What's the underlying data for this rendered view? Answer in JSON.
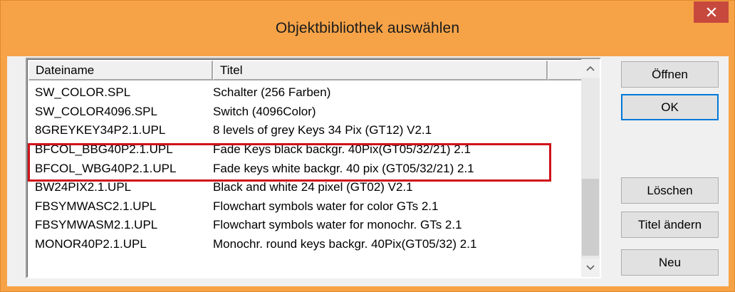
{
  "window": {
    "title": "Objektbibliothek auswählen",
    "close_symbol": "×"
  },
  "list": {
    "columns": [
      "Dateiname",
      "Titel",
      ""
    ],
    "rows": [
      {
        "file": "SW_COLOR.SPL",
        "title": "Schalter (256 Farben)"
      },
      {
        "file": "SW_COLOR4096.SPL",
        "title": "Switch (4096Color)"
      },
      {
        "file": "8GREYKEY34P2.1.UPL",
        "title": "8 levels of grey Keys 34 Pix (GT12) V2.1"
      },
      {
        "file": "BFCOL_BBG40P2.1.UPL",
        "title": "Fade Keys black backgr. 40Pix(GT05/32/21) 2.1"
      },
      {
        "file": "BFCOL_WBG40P2.1.UPL",
        "title": "Fade keys white backgr. 40 pix (GT05/32/21) 2.1"
      },
      {
        "file": "BW24PIX2.1.UPL",
        "title": "Black and white 24 pixel (GT02) V2.1"
      },
      {
        "file": "FBSYMWASC2.1.UPL",
        "title": "Flowchart symbols water for color GTs 2.1"
      },
      {
        "file": "FBSYMWASM2.1.UPL",
        "title": "Flowchart symbols water for monochr. GTs 2.1"
      },
      {
        "file": "MONOR40P2.1.UPL",
        "title": "Monochr. round keys backgr. 40Pix(GT05/32) 2.1"
      }
    ]
  },
  "buttons": {
    "open": "Öffnen",
    "ok": "OK",
    "delete": "Löschen",
    "rename_title": "Titel ändern",
    "new": "Neu"
  },
  "colors": {
    "titlebar": "#f6a348",
    "close_button": "#c7493e",
    "highlight_border": "#d0121b",
    "default_button_border": "#0078d7"
  },
  "icons": [
    "close-icon",
    "scroll-up-arrow-icon",
    "scroll-down-arrow-icon"
  ]
}
